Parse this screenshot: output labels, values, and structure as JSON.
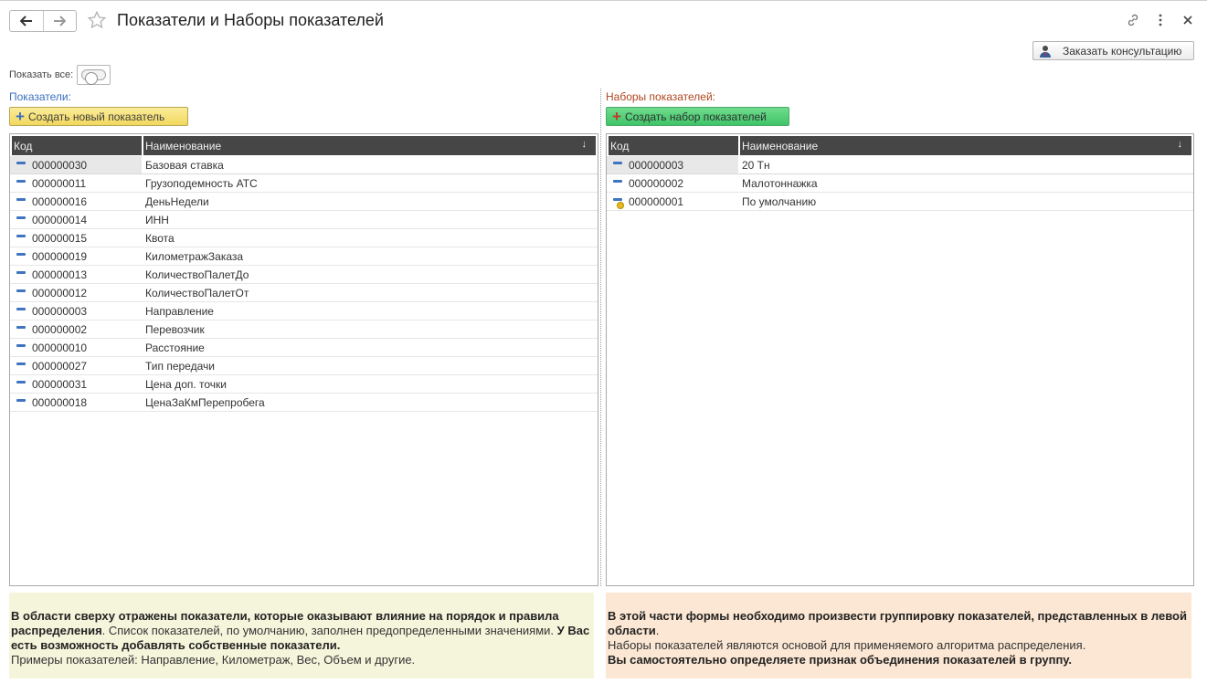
{
  "window": {
    "title": "Показатели и Наборы показателей",
    "consult_button": "Заказать консультацию"
  },
  "controls": {
    "show_all_label": "Показать все:",
    "show_all_enabled": false
  },
  "left_panel": {
    "label": "Показатели:",
    "create_button": "Создать новый показатель",
    "columns": {
      "code": "Код",
      "name": "Наименование"
    },
    "rows": [
      {
        "code": "000000030",
        "name": "Базовая ставка"
      },
      {
        "code": "000000011",
        "name": "Грузоподемность АТС"
      },
      {
        "code": "000000016",
        "name": "ДеньНедели"
      },
      {
        "code": "000000014",
        "name": "ИНН"
      },
      {
        "code": "000000015",
        "name": "Квота"
      },
      {
        "code": "000000019",
        "name": "КилометражЗаказа"
      },
      {
        "code": "000000013",
        "name": "КоличествоПалетДо"
      },
      {
        "code": "000000012",
        "name": "КоличествоПалетОт"
      },
      {
        "code": "000000003",
        "name": "Направление"
      },
      {
        "code": "000000002",
        "name": "Перевозчик"
      },
      {
        "code": "000000010",
        "name": "Расстояние"
      },
      {
        "code": "000000027",
        "name": "Тип передачи"
      },
      {
        "code": "000000031",
        "name": "Цена доп. точки"
      },
      {
        "code": "000000018",
        "name": "ЦенаЗаКмПерепробега"
      }
    ],
    "info": {
      "bold1": "В области сверху отражены показатели, которые оказывают влияние на порядок и правила распределения",
      "text1": ". Список показателей, по умолчанию, заполнен предопределенными значениями.",
      "bold2": " У Вас есть возможность добавлять собственные показатели.",
      "text2": "Примеры показателей: Направление, Километраж, Вес, Объем и другие."
    }
  },
  "right_panel": {
    "label": "Наборы показателей:",
    "create_button": "Создать набор показателей",
    "columns": {
      "code": "Код",
      "name": "Наименование"
    },
    "rows": [
      {
        "code": "000000003",
        "name": "20 Тн",
        "default": false
      },
      {
        "code": "000000002",
        "name": "Малотоннажка",
        "default": false
      },
      {
        "code": "000000001",
        "name": "По умолчанию",
        "default": true
      }
    ],
    "info": {
      "bold1": "В этой части формы необходимо произвести группировку показателей, представленных в левой области",
      "text1": ".",
      "text2": "Наборы показателей являются основой для применяемого алгоритма распределения.",
      "bold2": "Вы самостоятельно определяете признак объединения показателей в группу."
    }
  },
  "icons": {
    "back": "arrow-left-icon",
    "forward": "arrow-right-icon",
    "favorite": "star-icon",
    "link": "link-icon",
    "more": "more-vertical-icon",
    "close": "close-icon",
    "consult": "person-icon",
    "row": "catalog-item-icon",
    "row_default": "catalog-item-default-icon"
  },
  "colors": {
    "left_label": "#3a6fbf",
    "right_label": "#b0461e",
    "yellow_button": "#f2d85f",
    "green_button": "#3fc468",
    "header_bg": "#464646",
    "info_left_bg": "#f5f5dc",
    "info_right_bg": "#fbe7d3"
  }
}
